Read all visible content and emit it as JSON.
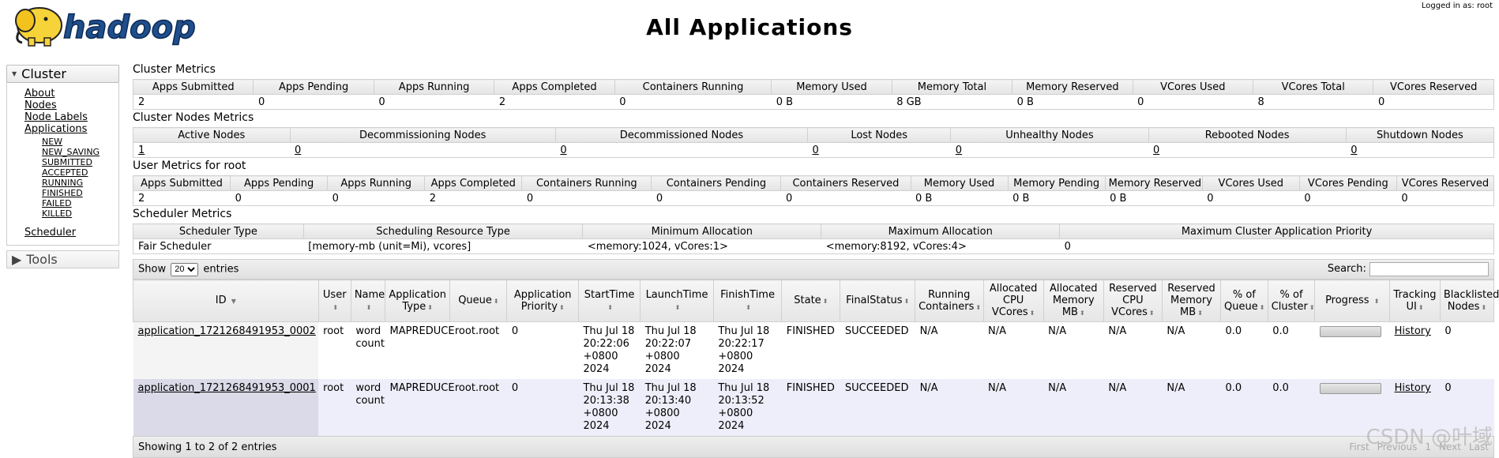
{
  "header": {
    "logo_text": "hadoop",
    "title": "All Applications",
    "logged_in": "Logged in as: root"
  },
  "sidebar": {
    "cluster_label": "Cluster",
    "links": [
      "About",
      "Nodes",
      "Node Labels",
      "Applications"
    ],
    "states": [
      "NEW",
      "NEW_SAVING",
      "SUBMITTED",
      "ACCEPTED",
      "RUNNING",
      "FINISHED",
      "FAILED",
      "KILLED"
    ],
    "scheduler": "Scheduler",
    "tools_label": "Tools"
  },
  "cluster_metrics": {
    "title": "Cluster Metrics",
    "headers": [
      "Apps Submitted",
      "Apps Pending",
      "Apps Running",
      "Apps Completed",
      "Containers Running",
      "Memory Used",
      "Memory Total",
      "Memory Reserved",
      "VCores Used",
      "VCores Total",
      "VCores Reserved"
    ],
    "values": [
      "2",
      "0",
      "0",
      "2",
      "0",
      "0 B",
      "8 GB",
      "0 B",
      "0",
      "8",
      "0"
    ]
  },
  "node_metrics": {
    "title": "Cluster Nodes Metrics",
    "headers": [
      "Active Nodes",
      "Decommissioning Nodes",
      "Decommissioned Nodes",
      "Lost Nodes",
      "Unhealthy Nodes",
      "Rebooted Nodes",
      "Shutdown Nodes"
    ],
    "values": [
      "1",
      "0",
      "0",
      "0",
      "0",
      "0",
      "0"
    ]
  },
  "user_metrics": {
    "title": "User Metrics for root",
    "headers": [
      "Apps Submitted",
      "Apps Pending",
      "Apps Running",
      "Apps Completed",
      "Containers Running",
      "Containers Pending",
      "Containers Reserved",
      "Memory Used",
      "Memory Pending",
      "Memory Reserved",
      "VCores Used",
      "VCores Pending",
      "VCores Reserved"
    ],
    "values": [
      "2",
      "0",
      "0",
      "2",
      "0",
      "0",
      "0",
      "0 B",
      "0 B",
      "0 B",
      "0",
      "0",
      "0"
    ]
  },
  "scheduler_metrics": {
    "title": "Scheduler Metrics",
    "headers": [
      "Scheduler Type",
      "Scheduling Resource Type",
      "Minimum Allocation",
      "Maximum Allocation",
      "Maximum Cluster Application Priority"
    ],
    "values": [
      "Fair Scheduler",
      "[memory-mb (unit=Mi), vcores]",
      "<memory:1024, vCores:1>",
      "<memory:8192, vCores:4>",
      "0"
    ]
  },
  "table_controls": {
    "show_label": "Show",
    "entries_value": "20",
    "entries_label": "entries",
    "search_label": "Search:"
  },
  "apps_table": {
    "headers": [
      "ID",
      "User",
      "Name",
      "Application Type",
      "Queue",
      "Application Priority",
      "StartTime",
      "LaunchTime",
      "FinishTime",
      "State",
      "FinalStatus",
      "Running Containers",
      "Allocated CPU VCores",
      "Allocated Memory MB",
      "Reserved CPU VCores",
      "Reserved Memory MB",
      "% of Queue",
      "% of Cluster",
      "Progress",
      "Tracking UI",
      "Blacklisted Nodes"
    ],
    "rows": [
      {
        "id": "application_1721268491953_0002",
        "user": "root",
        "name": "word count",
        "type": "MAPREDUCE",
        "queue": "root.root",
        "priority": "0",
        "start": "Thu Jul 18 20:22:06 +0800 2024",
        "launch": "Thu Jul 18 20:22:07 +0800 2024",
        "finish": "Thu Jul 18 20:22:17 +0800 2024",
        "state": "FINISHED",
        "final_status": "SUCCEEDED",
        "running": "N/A",
        "alloc_cpu": "N/A",
        "alloc_mem": "N/A",
        "res_cpu": "N/A",
        "res_mem": "N/A",
        "pct_queue": "0.0",
        "pct_cluster": "0.0",
        "progress": 100,
        "tracking": "History",
        "blacklisted": "0"
      },
      {
        "id": "application_1721268491953_0001",
        "user": "root",
        "name": "word count",
        "type": "MAPREDUCE",
        "queue": "root.root",
        "priority": "0",
        "start": "Thu Jul 18 20:13:38 +0800 2024",
        "launch": "Thu Jul 18 20:13:40 +0800 2024",
        "finish": "Thu Jul 18 20:13:52 +0800 2024",
        "state": "FINISHED",
        "final_status": "SUCCEEDED",
        "running": "N/A",
        "alloc_cpu": "N/A",
        "alloc_mem": "N/A",
        "res_cpu": "N/A",
        "res_mem": "N/A",
        "pct_queue": "0.0",
        "pct_cluster": "0.0",
        "progress": 100,
        "tracking": "History",
        "blacklisted": "0"
      }
    ]
  },
  "footer": {
    "showing": "Showing 1 to 2 of 2 entries",
    "pager": [
      "First",
      "Previous",
      "1",
      "Next",
      "Last"
    ]
  },
  "watermark": "CSDN @叶域"
}
